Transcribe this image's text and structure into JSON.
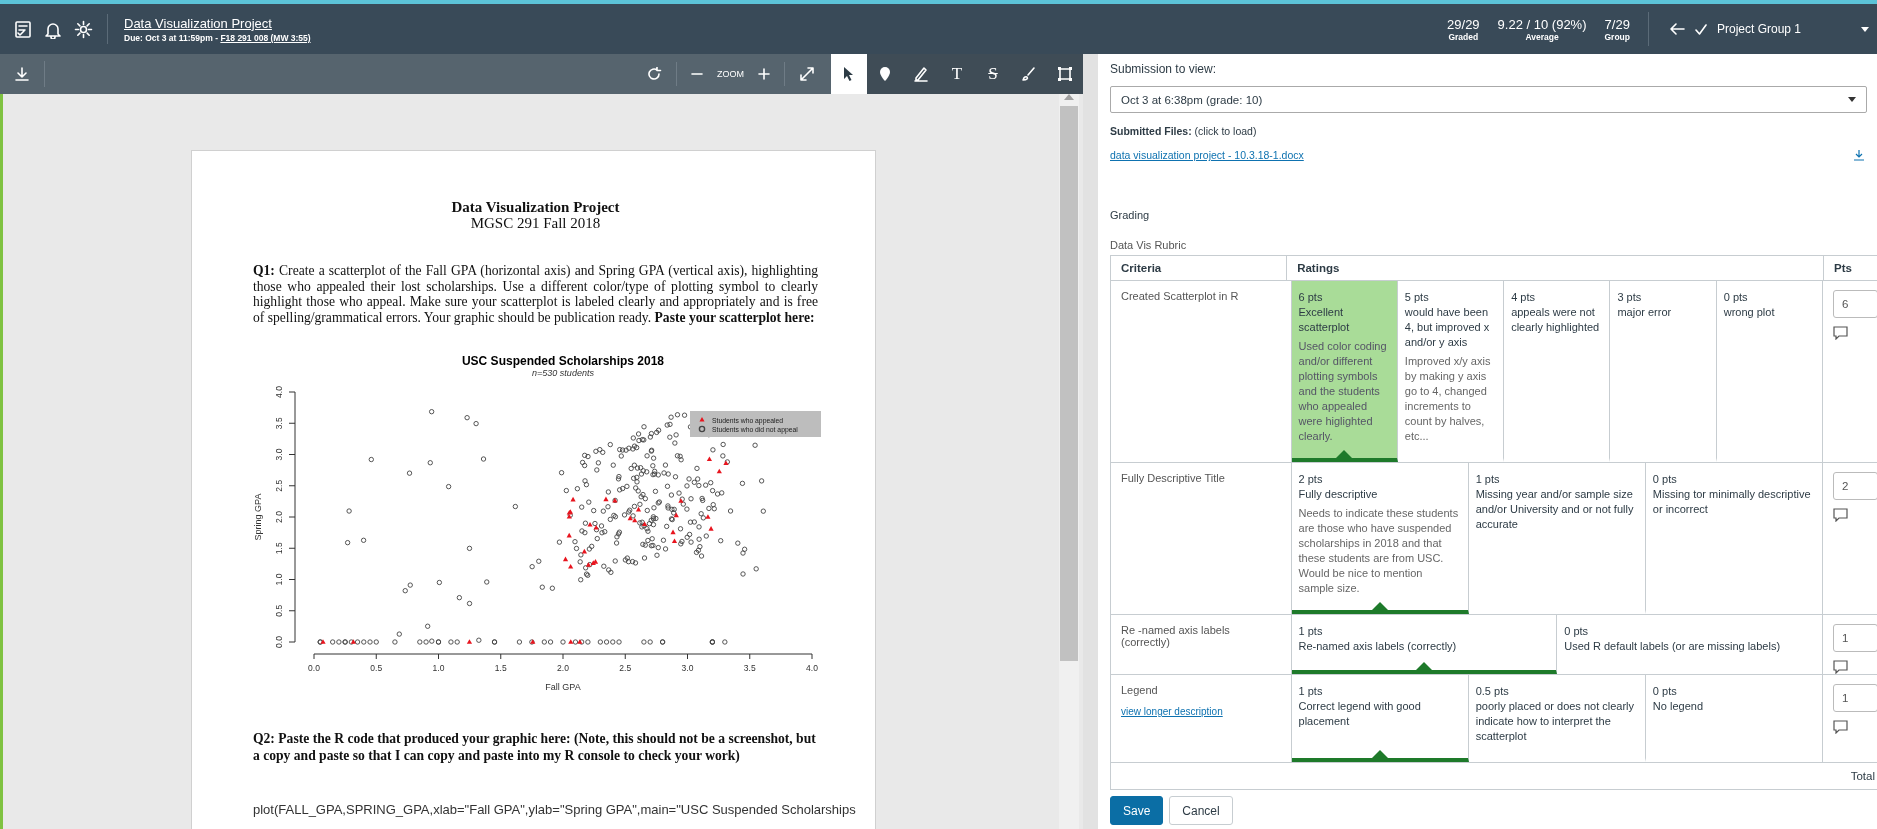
{
  "top_bar": {
    "title": "Data Visualization Project",
    "due": "Due: Oct 3 at 11:59pm - ",
    "course_link": "F18 291 008 (MW 3:55)",
    "stats": [
      {
        "value": "29/29",
        "label": "Graded"
      },
      {
        "value": "9.22 / 10 (92%)",
        "label": "Average"
      },
      {
        "value": "7/29",
        "label": "Group"
      }
    ],
    "student": {
      "name": "Project Group 1",
      "submitted": true
    }
  },
  "toolbar": {
    "zoom_label": "ZOOM",
    "tools": [
      {
        "kind": "pointer",
        "selected": true
      },
      {
        "kind": "pin",
        "selected": false
      },
      {
        "kind": "highlight",
        "selected": false
      },
      {
        "kind": "text",
        "glyph": "T",
        "selected": false
      },
      {
        "kind": "strike",
        "glyph": "S",
        "selected": false
      },
      {
        "kind": "draw",
        "selected": false
      },
      {
        "kind": "area",
        "selected": false
      }
    ]
  },
  "document": {
    "title": "Data Visualization Project",
    "subtitle": "MGSC 291 Fall 2018",
    "q1": "**Q1:** Create a scatterplot of the Fall GPA (horizontal axis) and Spring GPA (vertical axis), highlighting those who appealed their lost scholarships. Use a different color/type of plotting symbol to clearly highlight those who appeal. Make sure your scatterplot is labeled clearly and appropriately and is free of spelling/grammatical errors. Your graphic should be publication ready. **Paste your scatterplot here:**",
    "plot": {
      "title": "USC Suspended Scholarships 2018",
      "subtitle": "n=530 students",
      "xlabel": "Fall GPA",
      "ylabel": "Spring GPA",
      "xticks": [
        "0.0",
        "0.5",
        "1.0",
        "1.5",
        "2.0",
        "2.5",
        "3.0",
        "3.5",
        "4.0"
      ],
      "yticks": [
        "0.0",
        "0.5",
        "1.0",
        "1.5",
        "2.0",
        "2.5",
        "3.0",
        "3.5",
        "4.0"
      ],
      "legend": [
        {
          "kind": "triangle",
          "label": "Students who appealed",
          "color": "#e8141e"
        },
        {
          "kind": "circle",
          "label": "Students who did not appeal",
          "color": "#444444"
        }
      ]
    },
    "q2": "Q2: Paste the R code that produced your graphic here: (Note, this should not be a screenshot, but a copy and paste so that I can copy and paste into my R console to check your work)",
    "code": "plot(FALL_GPA,SPRING_GPA,xlab=\"Fall GPA\",ylab=\"Spring GPA\",main=\"USC Suspended Scholarships"
  },
  "submission": {
    "label": "Submission to view:",
    "selected": "Oct 3 at 6:38pm (grade: 10)",
    "files_label": "**Submitted Files:** (click to load)",
    "file": "data visualization project - 10.3.18-1.docx"
  },
  "grading": {
    "heading": "Grading",
    "rubric_title": "Data Vis Rubric",
    "columns": [
      "Criteria",
      "Ratings",
      "Pts"
    ],
    "rows": [
      {
        "criterion": "Created Scatterplot in R",
        "points": "6",
        "ratings": [
          {
            "points": "6 pts",
            "title": "Excellent scatterplot",
            "description": "Used color coding and/or different plotting symbols and the students who appealed were higlighted clearly.",
            "selected": true,
            "shaded": true
          },
          {
            "points": "5 pts",
            "title": "would have been 4, but improved x and/or y axis",
            "description": "Improved x/y axis by making y axis go to 4, changed increments to count by halves, etc...",
            "selected": false,
            "shaded": false
          },
          {
            "points": "4 pts",
            "title": "appeals were not clearly highlighted",
            "selected": false,
            "shaded": false
          },
          {
            "points": "3 pts",
            "title": "major error",
            "selected": false,
            "shaded": false
          },
          {
            "points": "0 pts",
            "title": "wrong plot",
            "selected": false,
            "shaded": false
          }
        ]
      },
      {
        "criterion": "Fully Descriptive Title",
        "points": "2",
        "ratings": [
          {
            "points": "2 pts",
            "title": "Fully descriptive",
            "description": "Needs to indicate these students are those who have suspended scholarships in 2018 and that these students are from USC. Would be nice to mention sample size.",
            "selected": true,
            "shaded": false
          },
          {
            "points": "1 pts",
            "title": "Missing year and/or sample size and/or University and or not fully accurate",
            "selected": false,
            "shaded": false
          },
          {
            "points": "0 pts",
            "title": "Missing tor minimally descriptive or incorrect",
            "selected": false,
            "shaded": false
          }
        ]
      },
      {
        "criterion": "Re -named axis labels (correctly)",
        "points": "1",
        "ratings": [
          {
            "points": "1 pts",
            "title": "Re-named axis labels (correctly)",
            "selected": true,
            "shaded": false
          },
          {
            "points": "0 pts",
            "title": "Used R default labels (or are missing labels)",
            "selected": false,
            "shaded": false
          }
        ]
      },
      {
        "criterion": "Legend",
        "link": "view longer description",
        "points": "1",
        "ratings": [
          {
            "points": "1 pts",
            "title": "Correct legend with good placement",
            "selected": true,
            "shaded": false
          },
          {
            "points": "0.5 pts",
            "title": "poorly placed or does not clearly indicate how to interpret the scatterplot",
            "selected": false,
            "shaded": false
          },
          {
            "points": "0 pts",
            "title": "No legend",
            "selected": false,
            "shaded": false
          }
        ]
      }
    ],
    "total_label": "Total",
    "buttons": [
      {
        "kind": "primary",
        "label": "Save"
      },
      {
        "kind": "secondary",
        "label": "Cancel"
      }
    ]
  }
}
